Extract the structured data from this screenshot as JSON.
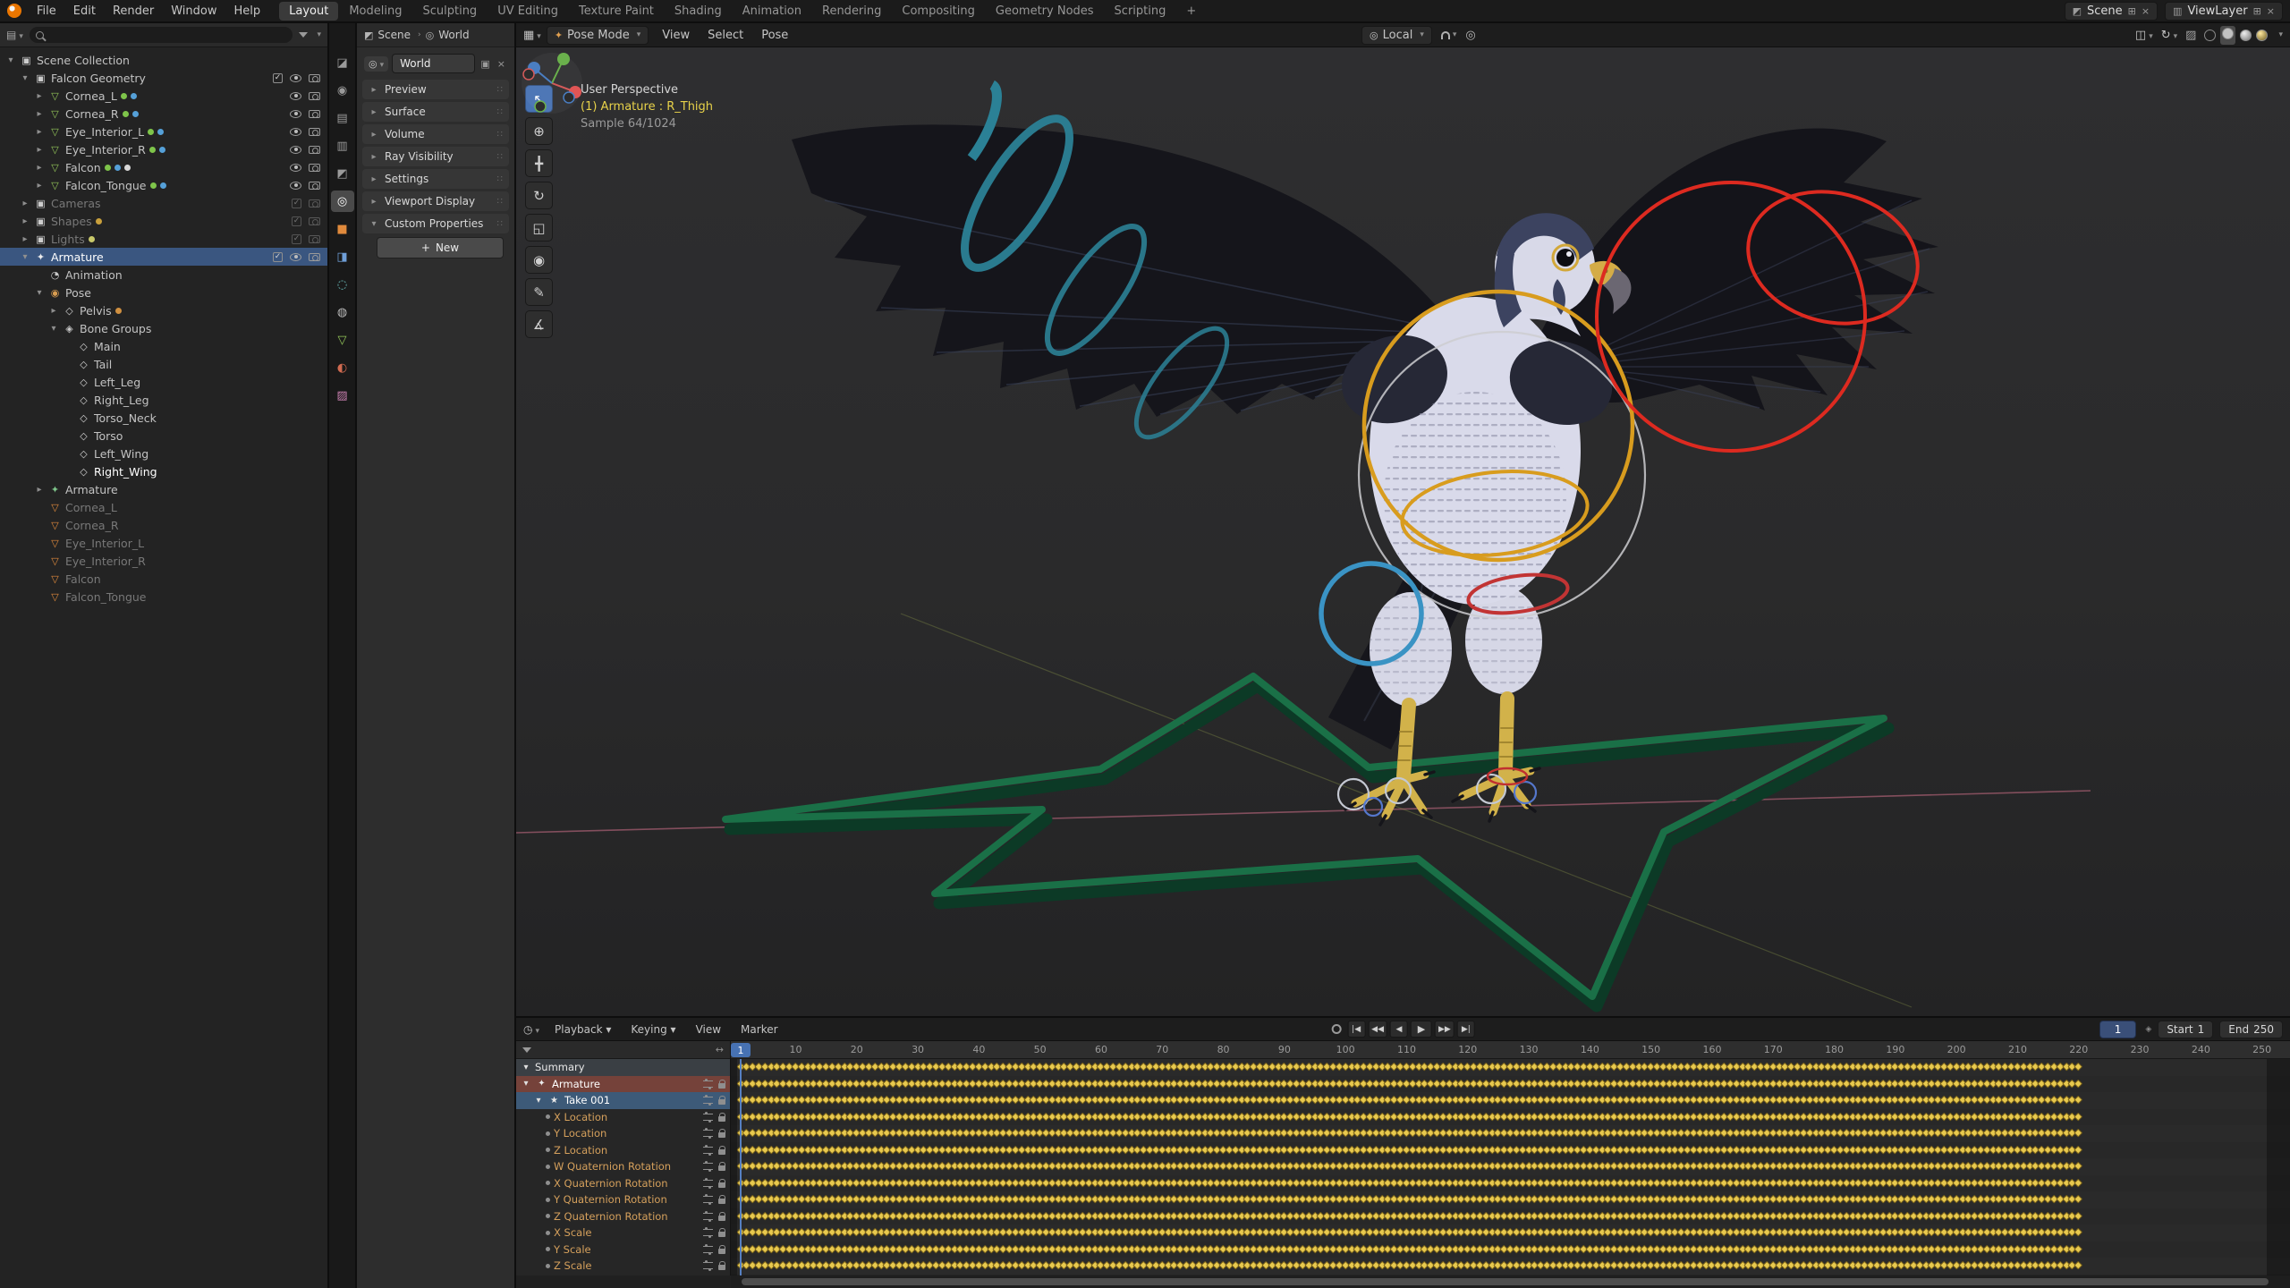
{
  "topbar": {
    "menus": [
      "File",
      "Edit",
      "Render",
      "Window",
      "Help"
    ],
    "workspaces": [
      "Layout",
      "Modeling",
      "Sculpting",
      "UV Editing",
      "Texture Paint",
      "Shading",
      "Animation",
      "Rendering",
      "Compositing",
      "Geometry Nodes",
      "Scripting"
    ],
    "active_workspace": "Layout",
    "add_workspace_label": "+",
    "scene": {
      "label": "Scene"
    },
    "view_layer": {
      "label": "ViewLayer"
    }
  },
  "outliner": {
    "items": [
      {
        "label": "Scene Collection",
        "depth": 0,
        "icon": "collection",
        "caret": "open"
      },
      {
        "label": "Falcon Geometry",
        "depth": 1,
        "icon": "collection",
        "caret": "open",
        "right": [
          "check",
          "eye",
          "cam"
        ]
      },
      {
        "label": "Cornea_L",
        "depth": 2,
        "icon": "mesh",
        "caret": "closed",
        "dots": [
          "#7ec44a",
          "#55a0d8"
        ],
        "right": [
          "eye",
          "cam"
        ]
      },
      {
        "label": "Cornea_R",
        "depth": 2,
        "icon": "mesh",
        "caret": "closed",
        "dots": [
          "#7ec44a",
          "#55a0d8"
        ],
        "right": [
          "eye",
          "cam"
        ]
      },
      {
        "label": "Eye_Interior_L",
        "depth": 2,
        "icon": "mesh",
        "caret": "closed",
        "dots": [
          "#7ec44a",
          "#55a0d8"
        ],
        "right": [
          "eye",
          "cam"
        ]
      },
      {
        "label": "Eye_Interior_R",
        "depth": 2,
        "icon": "mesh",
        "caret": "closed",
        "dots": [
          "#7ec44a",
          "#55a0d8"
        ],
        "right": [
          "eye",
          "cam"
        ]
      },
      {
        "label": "Falcon",
        "depth": 2,
        "icon": "mesh",
        "caret": "closed",
        "dots": [
          "#7ec44a",
          "#55a0d8",
          "#d8d8d8"
        ],
        "right": [
          "eye",
          "cam"
        ]
      },
      {
        "label": "Falcon_Tongue",
        "depth": 2,
        "icon": "mesh",
        "caret": "closed",
        "dots": [
          "#7ec44a",
          "#55a0d8"
        ],
        "right": [
          "eye",
          "cam"
        ]
      },
      {
        "label": "Cameras",
        "depth": 1,
        "icon": "collection",
        "caret": "closed",
        "faded": true,
        "right": [
          "check",
          "cam"
        ]
      },
      {
        "label": "Shapes",
        "depth": 1,
        "icon": "collection",
        "caret": "closed",
        "faded": true,
        "dots": [
          "#c9a03c"
        ],
        "right": [
          "check",
          "cam"
        ]
      },
      {
        "label": "Lights",
        "depth": 1,
        "icon": "collection",
        "caret": "closed",
        "faded": true,
        "dots": [
          "#c9c96a"
        ],
        "right": [
          "check",
          "cam"
        ]
      },
      {
        "label": "Armature",
        "depth": 1,
        "icon": "armature",
        "caret": "open",
        "selected": true,
        "right": [
          "check",
          "eye",
          "cam"
        ]
      },
      {
        "label": "Animation",
        "depth": 2,
        "icon": "anim"
      },
      {
        "label": "Pose",
        "depth": 2,
        "icon": "pose",
        "caret": "open"
      },
      {
        "label": "Pelvis",
        "depth": 3,
        "icon": "bone",
        "caret": "closed",
        "dots": [
          "#d09040"
        ]
      },
      {
        "label": "Bone Groups",
        "depth": 3,
        "icon": "group",
        "caret": "open"
      },
      {
        "label": "Main",
        "depth": 4,
        "icon": "bone"
      },
      {
        "label": "Tail",
        "depth": 4,
        "icon": "bone"
      },
      {
        "label": "Left_Leg",
        "depth": 4,
        "icon": "bone"
      },
      {
        "label": "Right_Leg",
        "depth": 4,
        "icon": "bone"
      },
      {
        "label": "Torso_Neck",
        "depth": 4,
        "icon": "bone"
      },
      {
        "label": "Torso",
        "depth": 4,
        "icon": "bone"
      },
      {
        "label": "Left_Wing",
        "depth": 4,
        "icon": "bone"
      },
      {
        "label": "Right_Wing",
        "depth": 4,
        "icon": "bone",
        "emph": true
      },
      {
        "label": "Armature",
        "depth": 2,
        "icon": "armature-data",
        "caret": "closed"
      },
      {
        "label": "Cornea_L",
        "depth": 2,
        "icon": "mesh-o",
        "faded": true
      },
      {
        "label": "Cornea_R",
        "depth": 2,
        "icon": "mesh-o",
        "faded": true
      },
      {
        "label": "Eye_Interior_L",
        "depth": 2,
        "icon": "mesh-o",
        "faded": true
      },
      {
        "label": "Eye_Interior_R",
        "depth": 2,
        "icon": "mesh-o",
        "faded": true
      },
      {
        "label": "Falcon",
        "depth": 2,
        "icon": "mesh-o",
        "faded": true
      },
      {
        "label": "Falcon_Tongue",
        "depth": 2,
        "icon": "mesh-o",
        "faded": true
      }
    ]
  },
  "properties": {
    "tabs": [
      "tool",
      "render",
      "output",
      "view-layer",
      "scene",
      "world",
      "object",
      "modifiers",
      "physics",
      "constraints",
      "object-data",
      "material",
      "texture"
    ],
    "active_tab": "world",
    "breadcrumb": {
      "scene": "Scene",
      "separator": "›",
      "target": "World"
    },
    "id_field": "World",
    "sections": [
      {
        "label": "Preview",
        "expanded": false
      },
      {
        "label": "Surface",
        "expanded": false
      },
      {
        "label": "Volume",
        "expanded": false
      },
      {
        "label": "Ray Visibility",
        "expanded": false
      },
      {
        "label": "Settings",
        "expanded": false
      },
      {
        "label": "Viewport Display",
        "expanded": false
      },
      {
        "label": "Custom Properties",
        "expanded": true
      }
    ],
    "new_button": "New"
  },
  "viewport": {
    "header": {
      "mode": "Pose Mode",
      "menus": [
        "View",
        "Select",
        "Pose"
      ],
      "orientation": "Local"
    },
    "tools": [
      "select-box",
      "cursor",
      "move",
      "rotate",
      "scale",
      "transform",
      "annotate",
      "measure"
    ],
    "overlay": {
      "line1": "User Perspective",
      "line2": "(1) Armature : R_Thigh",
      "line3": "Sample 64/1024"
    }
  },
  "timeline": {
    "menus": [
      "Playback",
      "Keying",
      "View",
      "Marker"
    ],
    "current_frame": "1",
    "start_label": "Start",
    "start_value": "1",
    "end_label": "End",
    "end_value": "250",
    "ruler": [
      10,
      20,
      30,
      40,
      50,
      60,
      70,
      80,
      90,
      100,
      110,
      120,
      130,
      140,
      150,
      160,
      170,
      180,
      190,
      200,
      210,
      220,
      230,
      240,
      250
    ],
    "frame_range": {
      "first": 1,
      "last": 250
    },
    "keys": {
      "first_frame": 1,
      "last_frame": 220
    },
    "playhead_frame": 1,
    "channels": [
      {
        "label": "Summary",
        "style": "summary",
        "indent": 0,
        "caret": true
      },
      {
        "label": "Armature",
        "style": "object",
        "indent": 0,
        "caret": true,
        "icon": "armature"
      },
      {
        "label": "Take 001",
        "style": "action",
        "indent": 1,
        "caret": true,
        "icon": "action"
      },
      {
        "label": "X Location",
        "style": "fcurve",
        "indent": 2
      },
      {
        "label": "Y Location",
        "style": "fcurve",
        "indent": 2
      },
      {
        "label": "Z Location",
        "style": "fcurve",
        "indent": 2
      },
      {
        "label": "W Quaternion Rotation",
        "style": "fcurve",
        "indent": 2
      },
      {
        "label": "X Quaternion Rotation",
        "style": "fcurve",
        "indent": 2
      },
      {
        "label": "Y Quaternion Rotation",
        "style": "fcurve",
        "indent": 2
      },
      {
        "label": "Z Quaternion Rotation",
        "style": "fcurve",
        "indent": 2
      },
      {
        "label": "X Scale",
        "style": "fcurve",
        "indent": 2
      },
      {
        "label": "Y Scale",
        "style": "fcurve",
        "indent": 2
      },
      {
        "label": "Z Scale",
        "style": "fcurve",
        "indent": 2
      }
    ]
  },
  "colors": {
    "accent": "#4772b3",
    "keyframe_yellow": "#e8c94e",
    "selection_blue": "#3a5680",
    "object_channel_red": "#75423a",
    "action_channel_blue": "#3d5a78",
    "star_green": "#1a7047",
    "gizmo_yellow": "#d89c1e",
    "gizmo_red": "#dd2a20",
    "gizmo_teal": "#2b8196"
  }
}
